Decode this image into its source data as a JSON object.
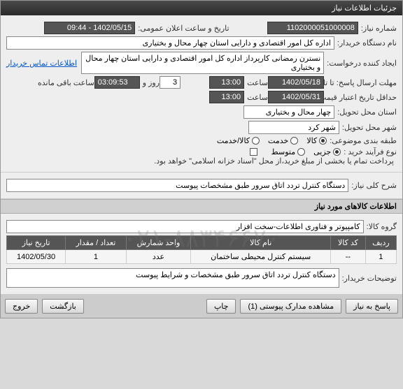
{
  "titlebar": "جزئیات اطلاعات نیاز",
  "labels": {
    "need_no": "شماره نیاز:",
    "announce_dt": "تاریخ و ساعت اعلان عمومی:",
    "buyer_name": "نام دستگاه خریدار:",
    "creator": "ایجاد کننده درخواست:",
    "contact_link": "اطلاعات تماس خریدار",
    "deadline": "مهلت ارسال پاسخ: تا تاریخ:",
    "time": "ساعت",
    "days_and": "روز و",
    "remain": "ساعت باقی مانده",
    "validity": "حداقل تاریخ اعتبار قیمت: تا تاریخ:",
    "province": "استان محل تحویل:",
    "city": "شهر محل تحویل:",
    "subject_cat": "طبقه بندی موضوعی:",
    "buy_type": "نوع فرآیند خرید :",
    "pay_note": "پرداخت تمام یا بخشی از مبلغ خرید،از محل \"اسناد خزانه اسلامی\" خواهد بود.",
    "need_desc": "شرح کلی نیاز:",
    "goods_title": "اطلاعات کالاهای مورد نیاز",
    "goods_group": "گروه کالا:",
    "buyer_notes": "توضیحات خریدار:"
  },
  "values": {
    "need_no": "1102000051000008",
    "announce_dt": "1402/05/15 - 09:44",
    "buyer_name": "اداره کل امور اقتصادی و دارایی استان چهار محال و بختیاری",
    "creator": "نسترن رمضانی کارپرداز اداره کل امور اقتصادی و دارایی استان چهار محال و بختیاری",
    "deadline_date": "1402/05/18",
    "deadline_time": "13:00",
    "days": "3",
    "countdown": "03:09:53",
    "validity_date": "1402/05/31",
    "validity_time": "13:00",
    "province": "چهار محال و بختیاری",
    "city": "شهر کرد",
    "need_desc": "دستگاه کنترل تردد اتاق سرور طبق مشخصات پیوست",
    "goods_group": "کامپیوتر و فناوری اطلاعات-سخت افزار",
    "buyer_notes": "دستگاه کنترل تردد اتاق سرور طبق مشخصات و شرایط پیوست"
  },
  "subject_cat": {
    "options": [
      "کالا",
      "خدمت",
      "کالا/خدمت"
    ],
    "selected": 0
  },
  "buy_type": {
    "options": [
      "جزیی",
      "متوسط"
    ],
    "selected": 0
  },
  "table": {
    "headers": [
      "ردیف",
      "کد کالا",
      "نام کالا",
      "واحد شمارش",
      "تعداد / مقدار",
      "تاریخ نیاز"
    ],
    "rows": [
      [
        "1",
        "--",
        "سیستم کنترل محیطی ساختمان",
        "عدد",
        "1",
        "1402/05/30"
      ]
    ]
  },
  "footer": {
    "respond": "پاسخ به نیاز",
    "attachments": "مشاهده مدارک پیوستی   (1)",
    "print": "چاپ",
    "back": "بازگشت",
    "exit": "خروج"
  },
  "watermark": "۰۲۱-۸۸۳۴۶۶۷۰"
}
